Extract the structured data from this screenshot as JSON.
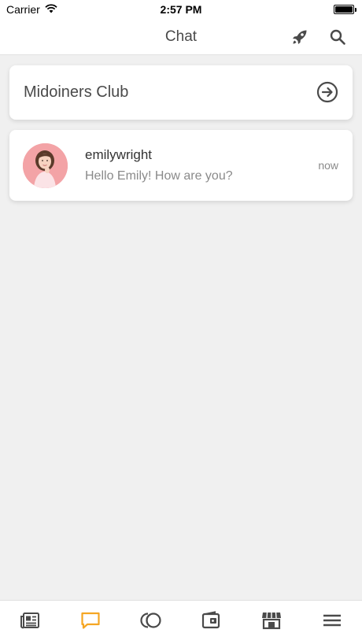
{
  "status_bar": {
    "carrier": "Carrier",
    "time": "2:57 PM"
  },
  "nav": {
    "title": "Chat",
    "icons": [
      "rocket-icon",
      "search-icon"
    ]
  },
  "club_card": {
    "title": "Midoiners Club",
    "icon": "arrow-right-circle-icon"
  },
  "chats": [
    {
      "name": "emilywright",
      "message": "Hello Emily! How are you?",
      "time": "now"
    }
  ],
  "tabs": [
    {
      "icon": "news-icon",
      "active": false
    },
    {
      "icon": "chat-icon",
      "active": true
    },
    {
      "icon": "coins-icon",
      "active": false
    },
    {
      "icon": "wallet-icon",
      "active": false
    },
    {
      "icon": "store-icon",
      "active": false
    },
    {
      "icon": "menu-icon",
      "active": false
    }
  ],
  "colors": {
    "accent": "#f5a623",
    "icon": "#4a4a4a",
    "background": "#f0f0f0"
  }
}
